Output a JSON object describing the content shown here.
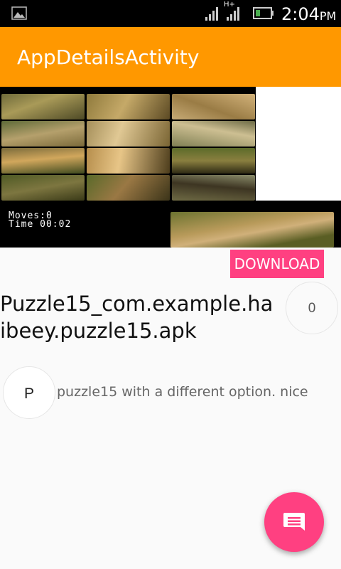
{
  "status_bar": {
    "network": "H+",
    "time": "2:04",
    "ampm": "PM",
    "icons": [
      "gallery-icon",
      "signal-icon",
      "signal-icon",
      "battery-icon"
    ]
  },
  "app_bar": {
    "title": "AppDetailsActivity"
  },
  "screenshot": {
    "moves_label": "Moves:0",
    "time_label": "Time 00:02"
  },
  "actions": {
    "download_label": "DOWNLOAD"
  },
  "app": {
    "title": "Puzzle15_com.example.haibeey.puzzle15.apk",
    "count": "0"
  },
  "comment": {
    "avatar_letter": "P",
    "text": "puzzle15 with a different option. nice"
  },
  "fab": {
    "icon": "comment-icon"
  },
  "colors": {
    "app_bar": "#ff9800",
    "accent": "#ff4081",
    "background": "#fafafa"
  }
}
